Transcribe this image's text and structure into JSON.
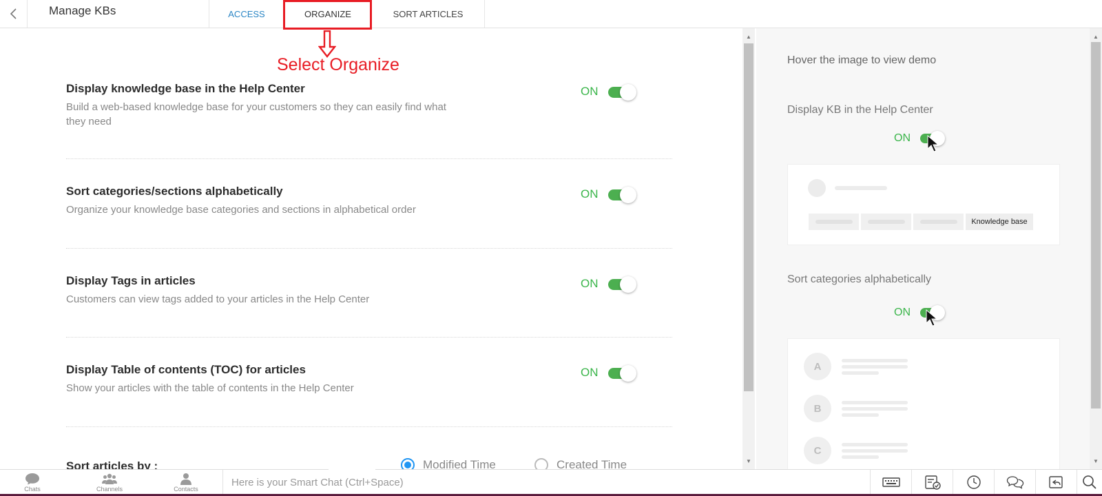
{
  "header": {
    "back_icon": "chevron-left-icon",
    "title": "Manage KBs",
    "tabs": [
      {
        "label": "ACCESS",
        "active": false
      },
      {
        "label": "ORGANIZE",
        "active": true
      },
      {
        "label": "SORT ARTICLES",
        "active": false
      }
    ]
  },
  "annotation": {
    "text": "Select Organize",
    "color": "#e81c24"
  },
  "settings": [
    {
      "title": "Display knowledge base in the Help Center",
      "description": "Build a web-based knowledge base for your customers so they can easily find what they need",
      "state": "ON"
    },
    {
      "title": "Sort categories/sections alphabetically",
      "description": "Organize your knowledge base categories and sections in alphabetical order",
      "state": "ON"
    },
    {
      "title": "Display Tags in articles",
      "description": "Customers can view tags added to your articles in the Help Center",
      "state": "ON"
    },
    {
      "title": "Display Table of contents (TOC) for articles",
      "description": "Show your articles with the table of contents in the Help Center",
      "state": "ON"
    }
  ],
  "sort_articles": {
    "label": "Sort articles by :",
    "options": [
      {
        "label": "Modified Time",
        "selected": true
      },
      {
        "label": "Created Time",
        "selected": false
      }
    ]
  },
  "demo_panel": {
    "hint": "Hover the image to view demo",
    "sections": [
      {
        "title": "Display KB in the Help Center",
        "state": "ON",
        "tab_label": "Knowledge base"
      },
      {
        "title": "Sort categories alphabetically",
        "state": "ON",
        "letters": [
          "A",
          "B",
          "C"
        ]
      }
    ]
  },
  "bottom_bar": {
    "nav": [
      {
        "label": "Chats",
        "icon": "chat-bubble-icon"
      },
      {
        "label": "Channels",
        "icon": "channels-icon"
      },
      {
        "label": "Contacts",
        "icon": "contact-person-icon"
      }
    ],
    "smart_chat_placeholder": "Here is your Smart Chat (Ctrl+Space)",
    "icons": [
      "keyboard-icon",
      "task-check-icon",
      "clock-icon",
      "conversation-icon",
      "share-icon",
      "search-icon"
    ]
  },
  "colors": {
    "accent_blue": "#2b86c5",
    "toggle_green": "#4caf50",
    "on_text_green": "#3ab54a",
    "highlight_red": "#e81c24",
    "bottom_strip": "#5a1a3c"
  }
}
